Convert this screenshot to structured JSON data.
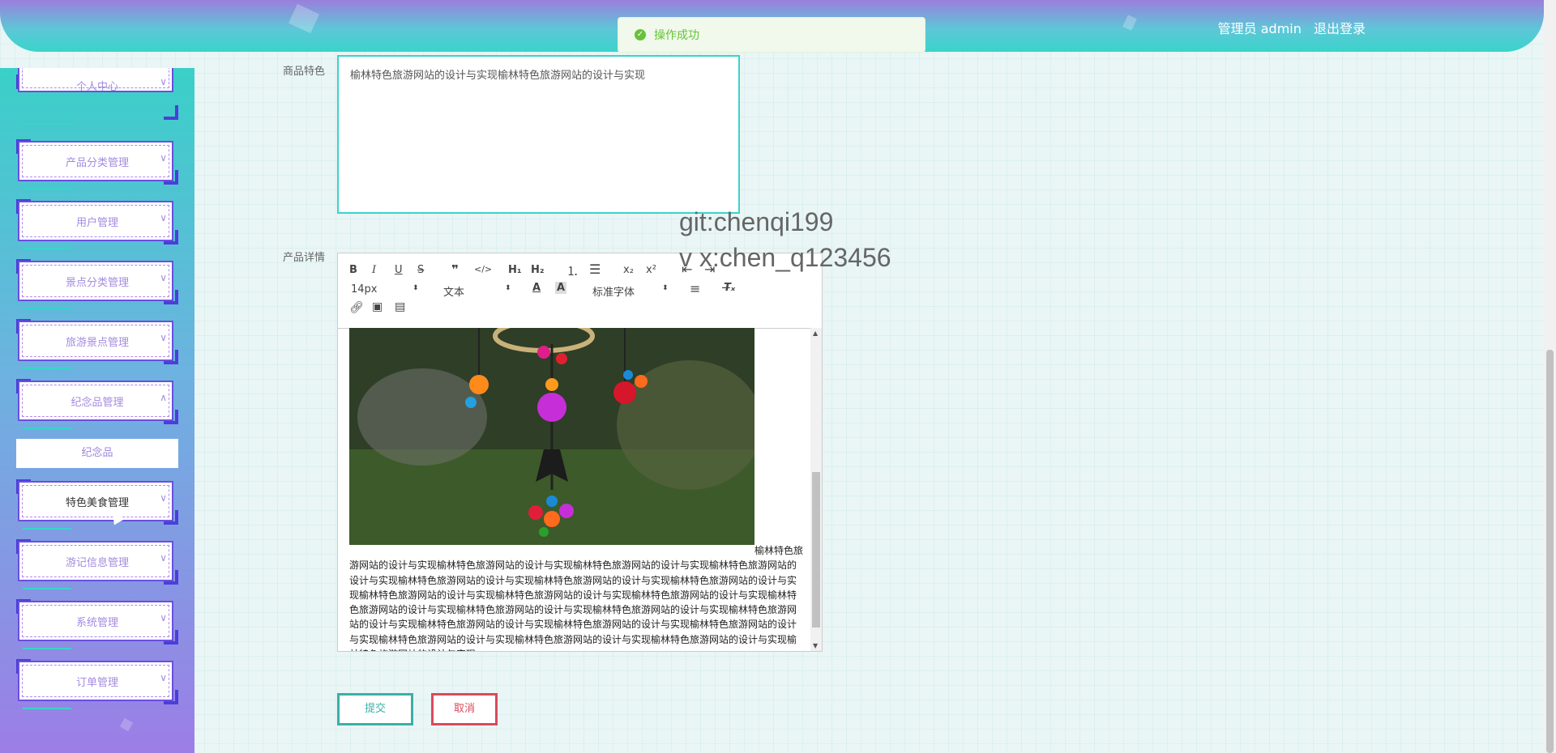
{
  "header": {
    "user_label": "管理员 admin",
    "logout_label": "退出登录"
  },
  "toast": {
    "message": "操作成功"
  },
  "sidebar": {
    "items": [
      {
        "label": "个人中心"
      },
      {
        "label": "产品分类管理"
      },
      {
        "label": "用户管理"
      },
      {
        "label": "景点分类管理"
      },
      {
        "label": "旅游景点管理"
      },
      {
        "label": "纪念品管理"
      },
      {
        "label": "特色美食管理"
      },
      {
        "label": "游记信息管理"
      },
      {
        "label": "系统管理"
      },
      {
        "label": "订单管理"
      }
    ],
    "submenu": {
      "label": "纪念品"
    }
  },
  "form": {
    "feature_label": "商品特色",
    "feature_value": "榆林特色旅游网站的设计与实现榆林特色旅游网站的设计与实现",
    "detail_label": "产品详情"
  },
  "watermark": {
    "line1": "git:chenqi199",
    "line2": "v x:chen_q123456"
  },
  "editor": {
    "font_size": "14px",
    "text_type": "文本",
    "font_family": "标准字体",
    "content_text": "榆林特色旅游网站的设计与实现榆林特色旅游网站的设计与实现榆林特色旅游网站的设计与实现榆林特色旅游网站的设计与实现榆林特色旅游网站的设计与实现榆林特色旅游网站的设计与实现榆林特色旅游网站的设计与实现榆林特色旅游网站的设计与实现榆林特色旅游网站的设计与实现榆林特色旅游网站的设计与实现榆林特色旅游网站的设计与实现榆林特色旅游网站的设计与实现榆林特色旅游网站的设计与实现榆林特色旅游网站的设计与实现榆林特色旅游网站的设计与实现榆林特色旅游网站的设计与实现榆林特色旅游网站的设计与实现榆林特色旅游网站的设计与实现榆林特色旅游网站的设计与实现榆林特色旅游网站的设计与实现榆林特色旅游网站的设计与实现"
  },
  "buttons": {
    "submit": "提交",
    "cancel": "取消"
  }
}
